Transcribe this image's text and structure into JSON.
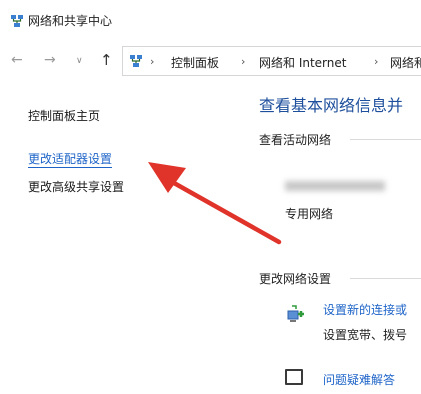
{
  "window": {
    "title": "网络和共享中心",
    "icon": "network-center-icon"
  },
  "navigation": {
    "back_icon": "back-arrow-icon",
    "forward_icon": "forward-arrow-icon",
    "recent_icon": "chevron-down-icon",
    "up_icon": "up-arrow-icon",
    "breadcrumb": [
      "控制面板",
      "网络和 Internet",
      "网络和"
    ],
    "separator": "›"
  },
  "left_pane": {
    "home_link": "控制面板主页",
    "adapter_link": "更改适配器设置",
    "advanced_link": "更改高级共享设置"
  },
  "main": {
    "heading": "查看基本网络信息并",
    "active_section": "查看活动网络",
    "network_type": "专用网络",
    "change_section": "更改网络设置",
    "tasks": [
      {
        "link": "设置新的连接或",
        "desc": "设置宽带、拨号",
        "icon": "new-connection-icon"
      },
      {
        "link": "问题疑难解答",
        "icon": "troubleshoot-icon"
      }
    ]
  },
  "annotation": {
    "arrow_color": "#e0332a",
    "arrow_icon": "red-arrow-annotation"
  }
}
